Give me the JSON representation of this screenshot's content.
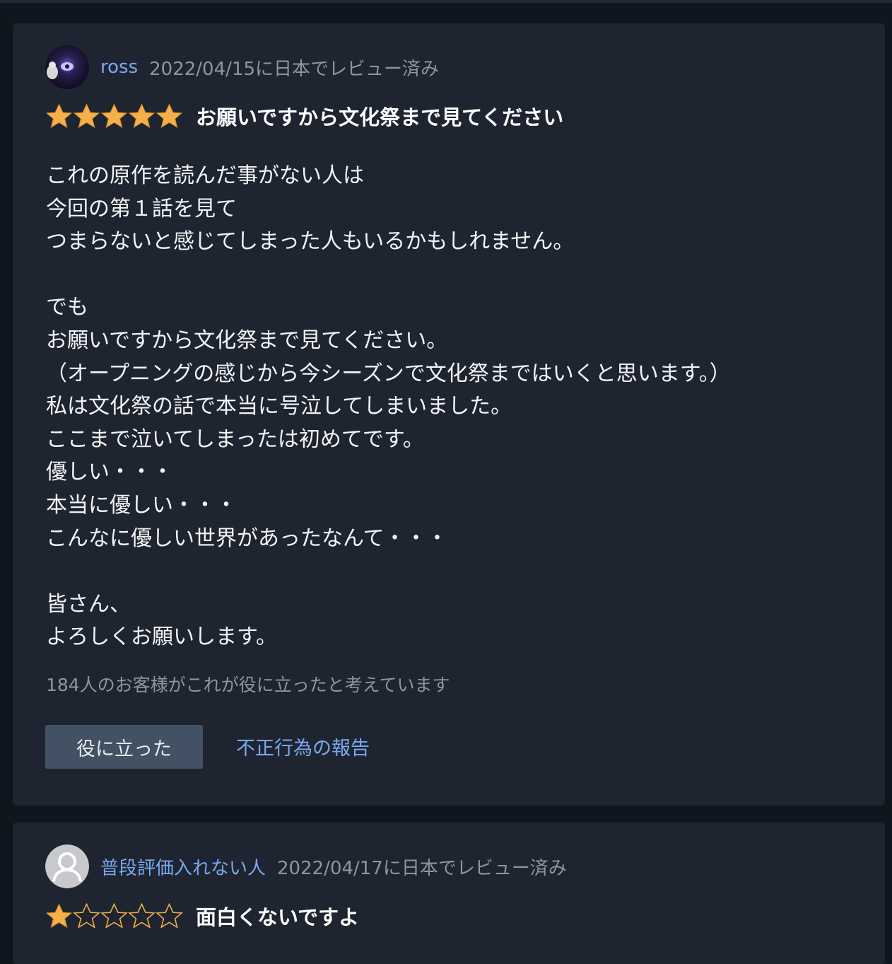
{
  "reviews": [
    {
      "reviewer": "ross",
      "date_text": "2022/04/15に日本でレビュー済み",
      "rating": 5,
      "title": "お願いですから文化祭まで見てください",
      "body_lines": [
        "これの原作を読んだ事がない人は",
        "今回の第１話を見て",
        "つまらないと感じてしまった人もいるかもしれません。",
        "",
        "でも",
        "お願いですから文化祭まで見てください。",
        "（オープニングの感じから今シーズンで文化祭まではいくと思います。）",
        "私は文化祭の話で本当に号泣してしまいました。",
        "ここまで泣いてしまったは初めてです。",
        "優しい・・・",
        "本当に優しい・・・",
        "こんなに優しい世界があったなんて・・・",
        "",
        "皆さん、",
        "よろしくお願いします。"
      ],
      "helpful_count_text": "184人のお客様がこれが役に立ったと考えています",
      "helpful_button": "役に立った",
      "report_link": "不正行為の報告"
    },
    {
      "reviewer": "普段評価入れない人",
      "date_text": "2022/04/17に日本でレビュー済み",
      "rating": 1,
      "title": "面白くないですよ"
    }
  ],
  "colors": {
    "background": "#0f171e",
    "card": "#1f2530",
    "link": "#79a8ef",
    "star": "#f5b04a",
    "button": "#425163"
  }
}
